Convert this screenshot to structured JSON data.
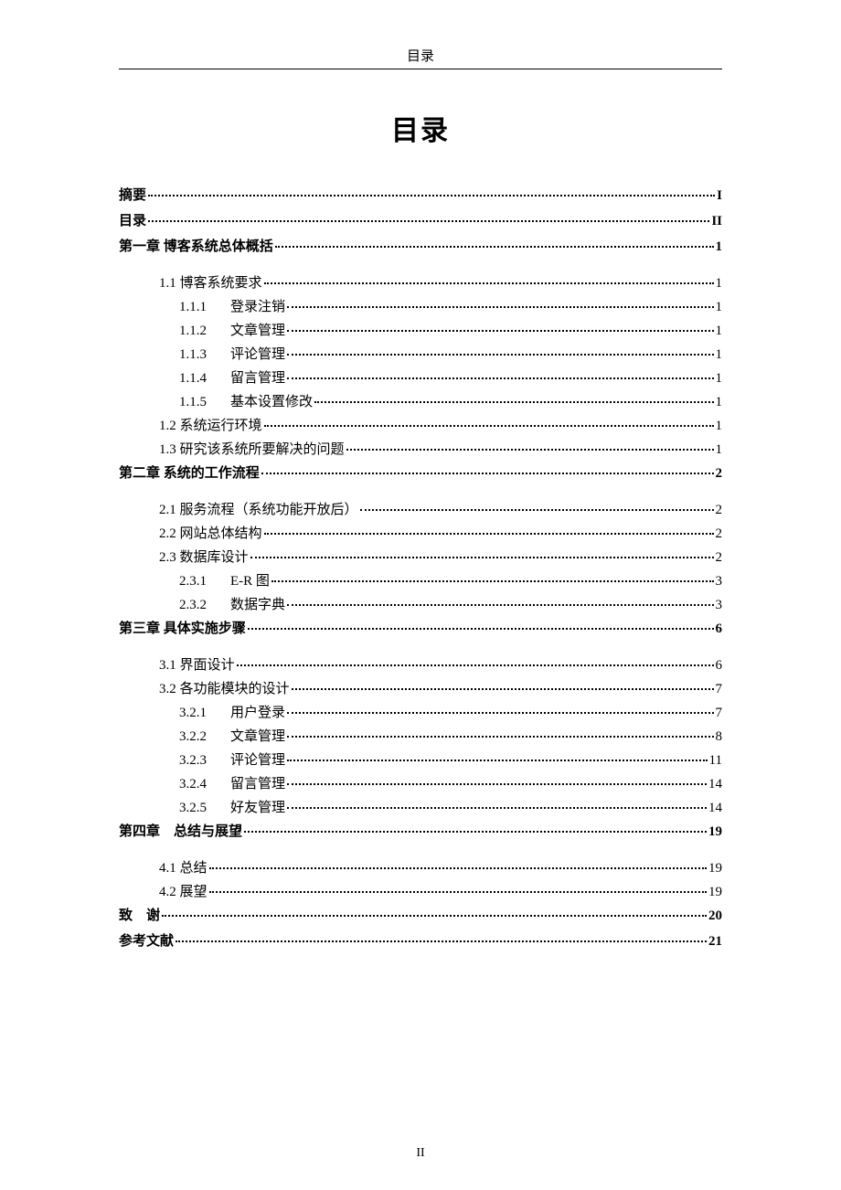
{
  "header": "目录",
  "title": "目录",
  "page_number": "II",
  "toc": [
    {
      "level": 0,
      "bold": true,
      "label": "摘要",
      "page": "I"
    },
    {
      "level": 0,
      "bold": true,
      "label": "目录",
      "page": "II"
    },
    {
      "level": 0,
      "bold": true,
      "label": "第一章  博客系统总体概括",
      "page": "1"
    },
    {
      "spacer": true
    },
    {
      "level": 1,
      "label": "1.1 博客系统要求",
      "page": "1"
    },
    {
      "level": 2,
      "num": "1.1.1",
      "label": "登录注销",
      "page": "1"
    },
    {
      "level": 2,
      "num": "1.1.2",
      "label": "文章管理",
      "page": "1"
    },
    {
      "level": 2,
      "num": "1.1.3",
      "label": "评论管理",
      "page": "1"
    },
    {
      "level": 2,
      "num": "1.1.4",
      "label": "留言管理",
      "page": "1"
    },
    {
      "level": 2,
      "num": "1.1.5",
      "label": "基本设置修改",
      "page": "1"
    },
    {
      "level": 1,
      "label": "1.2 系统运行环境",
      "page": "1"
    },
    {
      "level": 1,
      "label": "1.3 研究该系统所要解决的问题",
      "page": "1"
    },
    {
      "level": 0,
      "bold": true,
      "label": "第二章  系统的工作流程",
      "page": "2"
    },
    {
      "spacer": true
    },
    {
      "level": 1,
      "label": "2.1 服务流程（系统功能开放后）",
      "page": "2"
    },
    {
      "level": 1,
      "label": "2.2 网站总体结构",
      "page": "2"
    },
    {
      "level": 1,
      "label": "2.3 数据库设计",
      "page": "2"
    },
    {
      "level": 2,
      "num": "2.3.1",
      "label": "E-R 图",
      "page": "3"
    },
    {
      "level": 2,
      "num": "2.3.2",
      "label": "数据字典",
      "page": "3"
    },
    {
      "level": 0,
      "bold": true,
      "label": "第三章  具体实施步骤",
      "page": "6"
    },
    {
      "spacer": true
    },
    {
      "level": 1,
      "label": "3.1 界面设计",
      "page": "6"
    },
    {
      "level": 1,
      "label": "3.2 各功能模块的设计",
      "page": "7"
    },
    {
      "level": 2,
      "num": "3.2.1",
      "label": "用户登录",
      "page": "7"
    },
    {
      "level": 2,
      "num": "3.2.2",
      "label": "文章管理",
      "page": "8"
    },
    {
      "level": 2,
      "num": "3.2.3",
      "label": "评论管理",
      "page": "11"
    },
    {
      "level": 2,
      "num": "3.2.4",
      "label": "留言管理",
      "page": "14"
    },
    {
      "level": 2,
      "num": "3.2.5",
      "label": "好友管理",
      "page": "14"
    },
    {
      "level": 0,
      "bold": true,
      "label": "第四章　总结与展望",
      "page": "19"
    },
    {
      "spacer": true
    },
    {
      "level": 1,
      "label": "4.1 总结",
      "page": "19"
    },
    {
      "level": 1,
      "label": "4.2 展望",
      "page": "19"
    },
    {
      "level": 0,
      "bold": true,
      "label": "致　谢",
      "page": "20"
    },
    {
      "level": 0,
      "bold": true,
      "label": "参考文献",
      "page": "21"
    }
  ]
}
